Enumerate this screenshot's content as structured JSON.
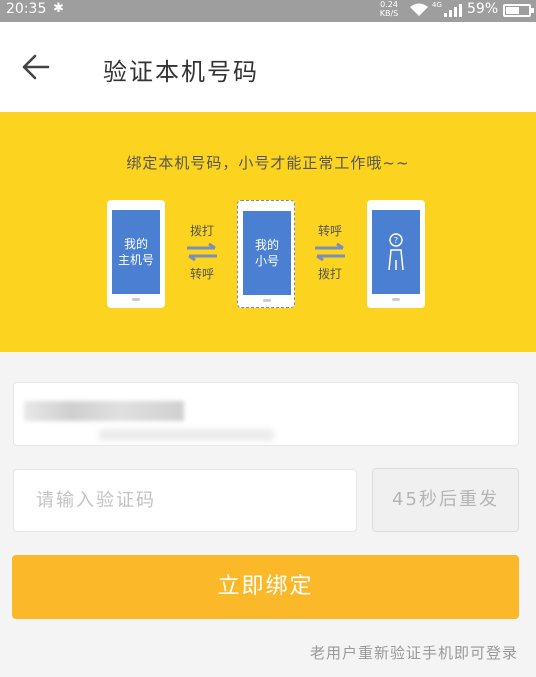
{
  "status_bar": {
    "time": "20:35",
    "bluetooth_icon": "bluetooth-icon",
    "net_speed_value": "0.24",
    "net_speed_unit": "KB/S",
    "network_type": "4G",
    "battery_percent": "59%",
    "battery_level": 0.59
  },
  "header": {
    "back_icon": "arrow-left-icon",
    "title": "验证本机号码"
  },
  "banner": {
    "tagline": "绑定本机号码，小号才能正常工作哦~~",
    "phone_main_line1": "我的",
    "phone_main_line2": "主机号",
    "arrow1_top": "拨打",
    "arrow1_bottom": "转呼",
    "phone_small_line1": "我的",
    "phone_small_line2": "小号",
    "arrow2_top": "转呼",
    "arrow2_bottom": "拨打",
    "person_icon": "person-question-icon",
    "accent_color": "#fcd41f",
    "screen_color": "#4a7fd1"
  },
  "form": {
    "phone_value": "",
    "code_placeholder": "请输入验证码",
    "resend_label": "45秒后重发",
    "submit_label": "立即绑定",
    "submit_color": "#fbb828"
  },
  "footer": {
    "hint": "老用户重新验证手机即可登录"
  }
}
